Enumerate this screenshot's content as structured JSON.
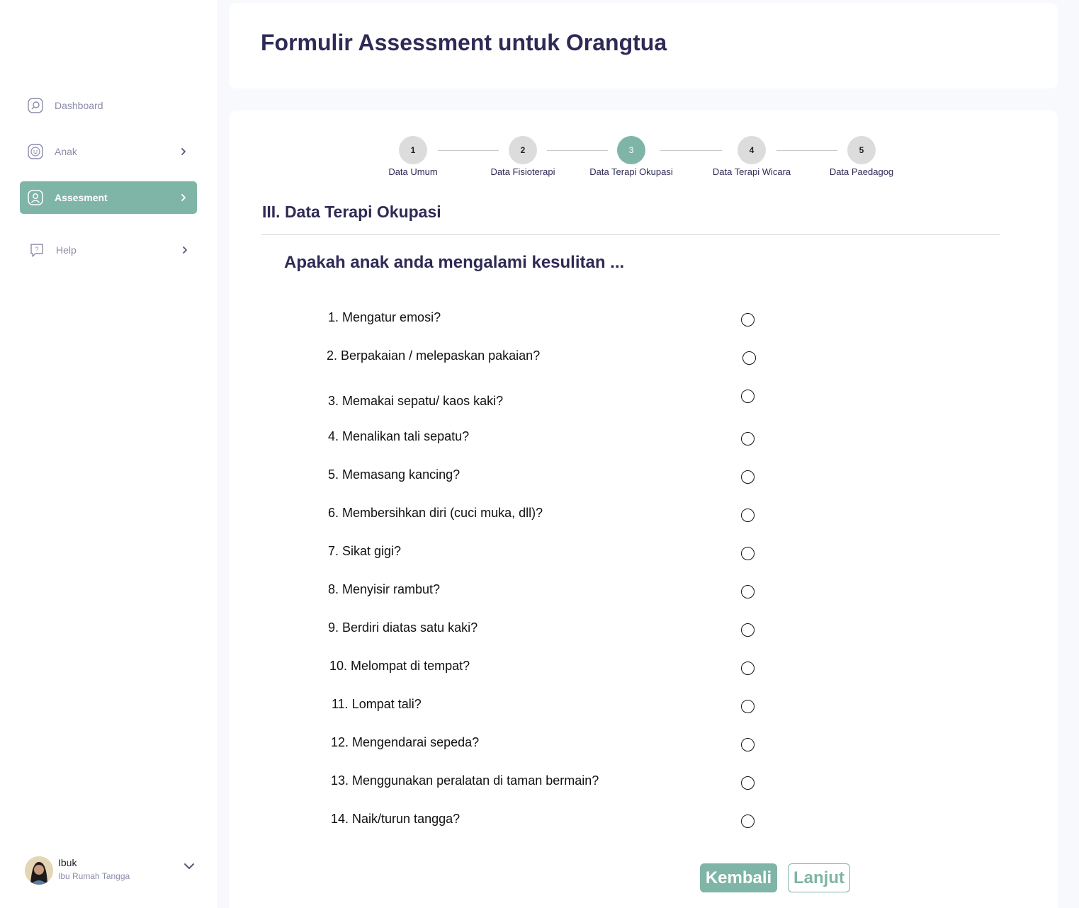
{
  "sidebar": {
    "items": [
      {
        "label": "Dashboard",
        "icon": "dashboard-icon",
        "active": false
      },
      {
        "label": "Anak",
        "icon": "smiley-face-icon",
        "active": false
      },
      {
        "label": "Assesment",
        "icon": "user-profile-icon",
        "active": true
      },
      {
        "label": "Help",
        "icon": "help-question-icon",
        "active": false
      }
    ],
    "user": {
      "name": "Ibuk",
      "role": "Ibu Rumah Tangga"
    }
  },
  "header": {
    "title": "Formulir Assessment untuk Orangtua"
  },
  "stepper": {
    "steps": [
      {
        "number": "1",
        "label": "Data Umum"
      },
      {
        "number": "2",
        "label": "Data Fisioterapi"
      },
      {
        "number": "3",
        "label": "Data Terapi Okupasi"
      },
      {
        "number": "4",
        "label": "Data Terapi Wicara"
      },
      {
        "number": "5",
        "label": "Data Paedagog"
      }
    ],
    "active_step": 3
  },
  "section": {
    "title": "III. Data Terapi Okupasi",
    "subtitle": "Apakah anak anda mengalami kesulitan ...",
    "questions": [
      "1. Mengatur emosi?",
      "2. Berpakaian / melepaskan pakaian?",
      "3. Memakai sepatu/ kaos kaki?",
      "4. Menalikan tali sepatu?",
      "5. Memasang kancing?",
      "6. Membersihkan diri (cuci muka, dll)?",
      "7. Sikat gigi?",
      "8. Menyisir rambut?",
      "9. Berdiri diatas satu kaki?",
      "10. Melompat di tempat?",
      "11. Lompat tali?",
      "12. Mengendarai sepeda?",
      "13. Menggunakan peralatan di taman bermain?",
      "14. Naik/turun tangga?"
    ]
  },
  "buttons": {
    "back": "Kembali",
    "next": "Lanjut"
  },
  "colors": {
    "accent": "#7fb5a6",
    "title": "#2e2a55",
    "muted": "#8b8ca8"
  }
}
